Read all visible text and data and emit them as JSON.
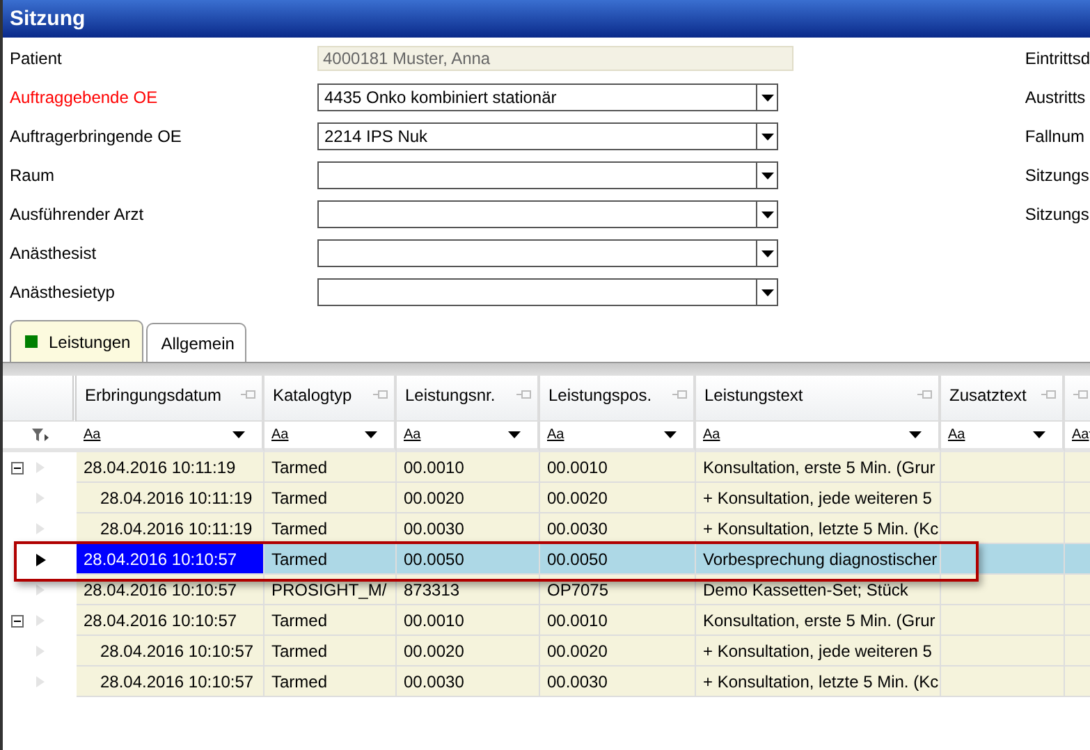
{
  "window": {
    "title": "Sitzung"
  },
  "form": [
    {
      "label": "Patient",
      "kind": "readonly",
      "required": false,
      "value": "4000181 Muster,  Anna"
    },
    {
      "label": "Auftraggebende OE",
      "kind": "combo",
      "required": true,
      "value": "4435 Onko kombiniert stationär"
    },
    {
      "label": "Auftragerbringende OE",
      "kind": "combo",
      "required": false,
      "value": "2214 IPS Nuk"
    },
    {
      "label": "Raum",
      "kind": "combo",
      "required": false
    },
    {
      "label": "Ausführender Arzt",
      "kind": "combo",
      "required": false
    },
    {
      "label": "Anästhesist",
      "kind": "combo",
      "required": false
    },
    {
      "label": "Anästhesietyp",
      "kind": "combo",
      "required": false
    }
  ],
  "side_labels": [
    "Eintrittsd",
    "Austritts",
    "Fallnum",
    "Sitzungs",
    "Sitzungs"
  ],
  "tabs": [
    {
      "label": "Leistungen",
      "selected": true
    },
    {
      "label": "Allgemein",
      "selected": false
    }
  ],
  "table": {
    "columns": [
      {
        "label": "Erbringungsdatum",
        "filter": "Aa"
      },
      {
        "label": "Katalogtyp",
        "filter": "Aa"
      },
      {
        "label": "Leistungsnr.",
        "filter": "Aa"
      },
      {
        "label": "Leistungspos.",
        "filter": "Aa"
      },
      {
        "label": "Leistungstext",
        "filter": "Aa"
      },
      {
        "label": "Zusatztext",
        "filter": "Aa"
      },
      {
        "filter": "Aa"
      }
    ],
    "rows": [
      {
        "expanded": true,
        "selected": false,
        "cells": [
          "28.04.2016 10:11:19",
          "Tarmed",
          "00.0010",
          "00.0010",
          "Konsultation, erste 5 Min. (Grur"
        ],
        "children": [
          {
            "selected": false,
            "cells": [
              "28.04.2016 10:11:19",
              "Tarmed",
              "00.0020",
              "00.0020",
              "+ Konsultation, jede weiteren 5"
            ]
          },
          {
            "selected": false,
            "cells": [
              "28.04.2016 10:11:19",
              "Tarmed",
              "00.0030",
              "00.0030",
              "+ Konsultation, letzte 5 Min. (Kc"
            ]
          }
        ]
      },
      {
        "expanded": false,
        "selected": true,
        "cells": [
          "28.04.2016 10:10:57",
          "Tarmed",
          "00.0050",
          "00.0050",
          "Vorbesprechung diagnostischer"
        ]
      },
      {
        "expanded": false,
        "selected": false,
        "cells": [
          "28.04.2016 10:10:57",
          "PROSIGHT_M/",
          "873313",
          "OP7075",
          "Demo Kassetten-Set; Stück"
        ]
      },
      {
        "expanded": true,
        "selected": false,
        "cells": [
          "28.04.2016 10:10:57",
          "Tarmed",
          "00.0010",
          "00.0010",
          "Konsultation, erste 5 Min. (Grur"
        ],
        "children": [
          {
            "selected": false,
            "cells": [
              "28.04.2016 10:10:57",
              "Tarmed",
              "00.0020",
              "00.0020",
              "+ Konsultation, jede weiteren 5"
            ]
          },
          {
            "selected": false,
            "cells": [
              "28.04.2016 10:10:57",
              "Tarmed",
              "00.0030",
              "00.0030",
              "+ Konsultation, letzte 5 Min. (Kc"
            ]
          }
        ]
      }
    ]
  }
}
